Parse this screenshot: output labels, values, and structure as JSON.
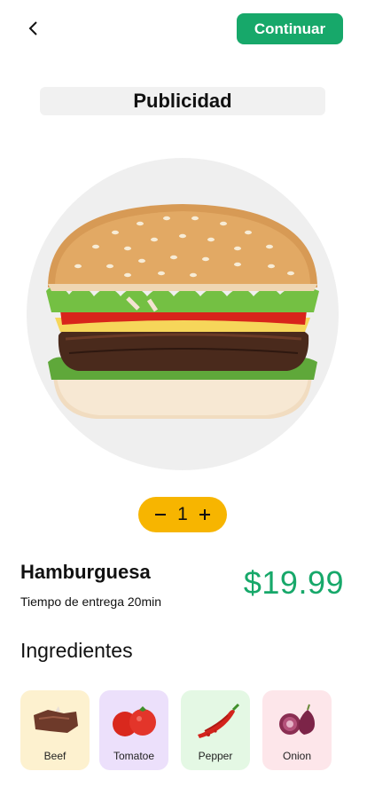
{
  "header": {
    "continue_label": "Continuar"
  },
  "ad": {
    "label": "Publicidad"
  },
  "quantity": {
    "minus": "−",
    "value": "1",
    "plus": "+"
  },
  "product": {
    "name": "Hamburguesa",
    "delivery": "Tiempo de entrega 20min",
    "price": "$19.99"
  },
  "ingredients": {
    "title": "Ingredientes",
    "items": [
      {
        "label": "Beef",
        "bg": "#fdf1cf"
      },
      {
        "label": "Tomatoe",
        "bg": "#ece0fb"
      },
      {
        "label": "Pepper",
        "bg": "#e4f8e4"
      },
      {
        "label": "Onion",
        "bg": "#fde6ea"
      }
    ]
  },
  "colors": {
    "accent": "#17a86a",
    "qty_bg": "#f7b500"
  }
}
